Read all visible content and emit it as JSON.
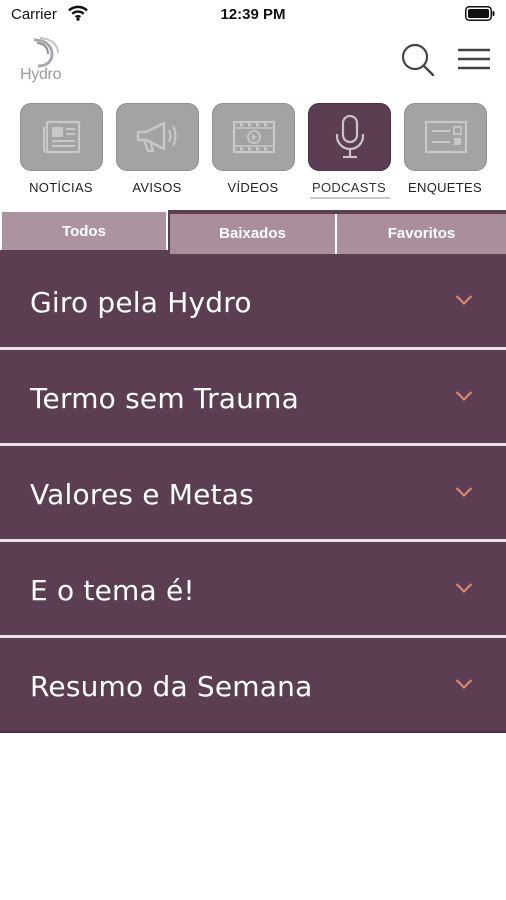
{
  "status_bar": {
    "carrier": "Carrier",
    "time": "12:39 PM"
  },
  "header": {
    "logo_text": "Hydro"
  },
  "categories": [
    {
      "label": "NOTÍCIAS",
      "icon": "newspaper-icon",
      "active": false
    },
    {
      "label": "AVISOS",
      "icon": "megaphone-icon",
      "active": false
    },
    {
      "label": "VÍDEOS",
      "icon": "video-icon",
      "active": false
    },
    {
      "label": "PODCASTS",
      "icon": "microphone-icon",
      "active": true
    },
    {
      "label": "ENQUETES",
      "icon": "poll-icon",
      "active": false
    }
  ],
  "tabs": [
    {
      "label": "Todos",
      "selected": true
    },
    {
      "label": "Baixados",
      "selected": false
    },
    {
      "label": "Favoritos",
      "selected": false
    }
  ],
  "podcasts": [
    {
      "title": "Giro pela Hydro"
    },
    {
      "title": "Termo sem Trauma"
    },
    {
      "title": "Valores e Metas"
    },
    {
      "title": "E o tema é!"
    },
    {
      "title": "Resumo da Semana"
    }
  ],
  "colors": {
    "primary": "#5c3e52",
    "tab_inactive": "#a98f9c",
    "chevron": "#d9876a",
    "tile_inactive": "#a3a3a3"
  }
}
